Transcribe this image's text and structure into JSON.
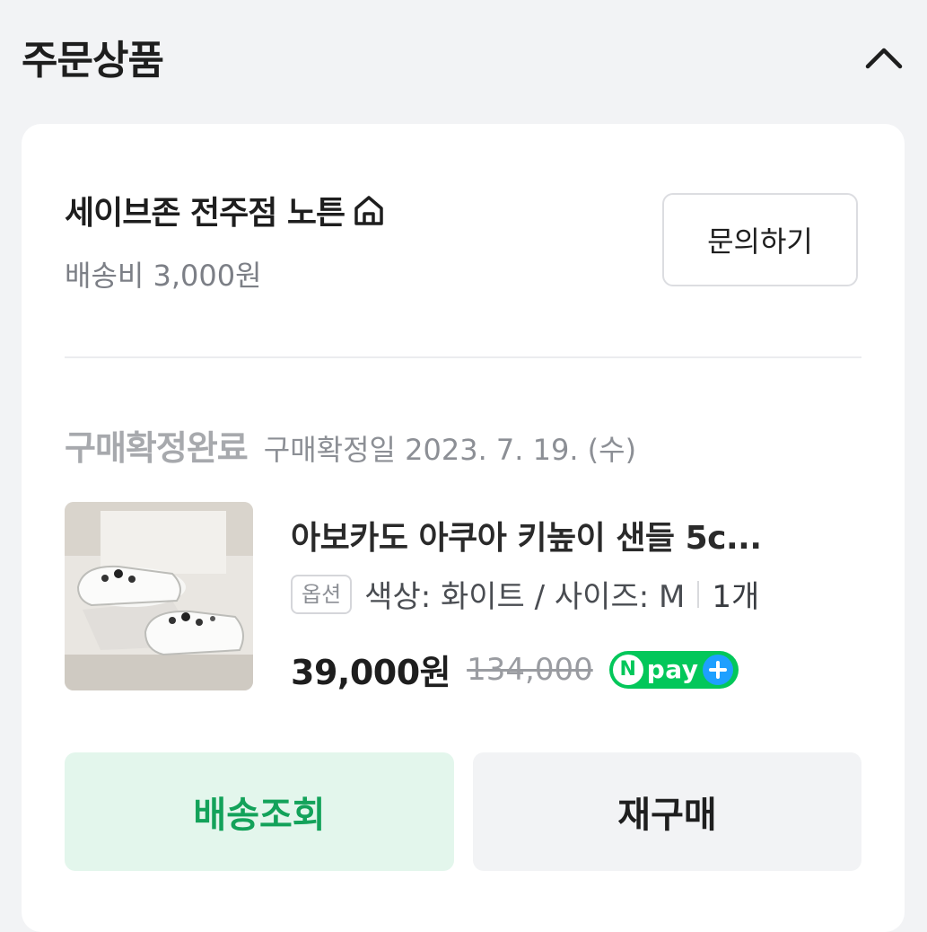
{
  "header": {
    "title": "주문상품",
    "collapse_icon": "chevron-up-icon"
  },
  "store": {
    "name": "세이브존 전주점 노튼",
    "home_icon": "home-icon",
    "shipping_fee": "배송비 3,000원",
    "inquiry_label": "문의하기"
  },
  "order": {
    "status": "구매확정완료",
    "confirm_date": "구매확정일 2023. 7. 19. (수)"
  },
  "product": {
    "name": "아보카도 아쿠아 키높이 샌들 5c...",
    "option_badge": "옵션",
    "option_text": "색상: 화이트 / 사이즈: M",
    "quantity": "1개",
    "price": "39,000원",
    "original_price": "134,000",
    "npay_label": "pay",
    "npay_n": "N"
  },
  "actions": {
    "track_label": "배송조회",
    "reorder_label": "재구매"
  },
  "colors": {
    "accent_green": "#13a25a",
    "track_bg": "#e3f6ec",
    "npay_green": "#03c75a"
  }
}
